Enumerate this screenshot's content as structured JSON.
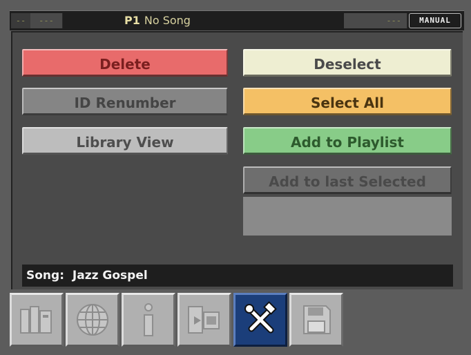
{
  "status_bar": {
    "segment_a": "--",
    "segment_b": "---",
    "program": "P1",
    "song_name": "No Song",
    "segment_d": "---",
    "mode": "MANUAL"
  },
  "actions": {
    "delete": "Delete",
    "id_renumber": "ID Renumber",
    "library_view": "Library View",
    "deselect": "Deselect",
    "select_all": "Select All",
    "add_to_playlist": "Add to Playlist",
    "add_to_last_selected": "Add to last Selected"
  },
  "selection": {
    "label": "Song:",
    "value": "Jazz Gospel"
  },
  "toolbar": {
    "items": [
      {
        "icon": "library-icon",
        "active": false
      },
      {
        "icon": "globe-icon",
        "active": false
      },
      {
        "icon": "info-icon",
        "active": false
      },
      {
        "icon": "transfer-icon",
        "active": false
      },
      {
        "icon": "tools-icon",
        "active": true
      },
      {
        "icon": "save-icon",
        "active": false
      }
    ]
  },
  "colors": {
    "delete": "#e86b6b",
    "select_all": "#f4c065",
    "add_to_playlist": "#88cc88",
    "deselect": "#eeeed2",
    "active_tool": "#1b3e7a"
  }
}
